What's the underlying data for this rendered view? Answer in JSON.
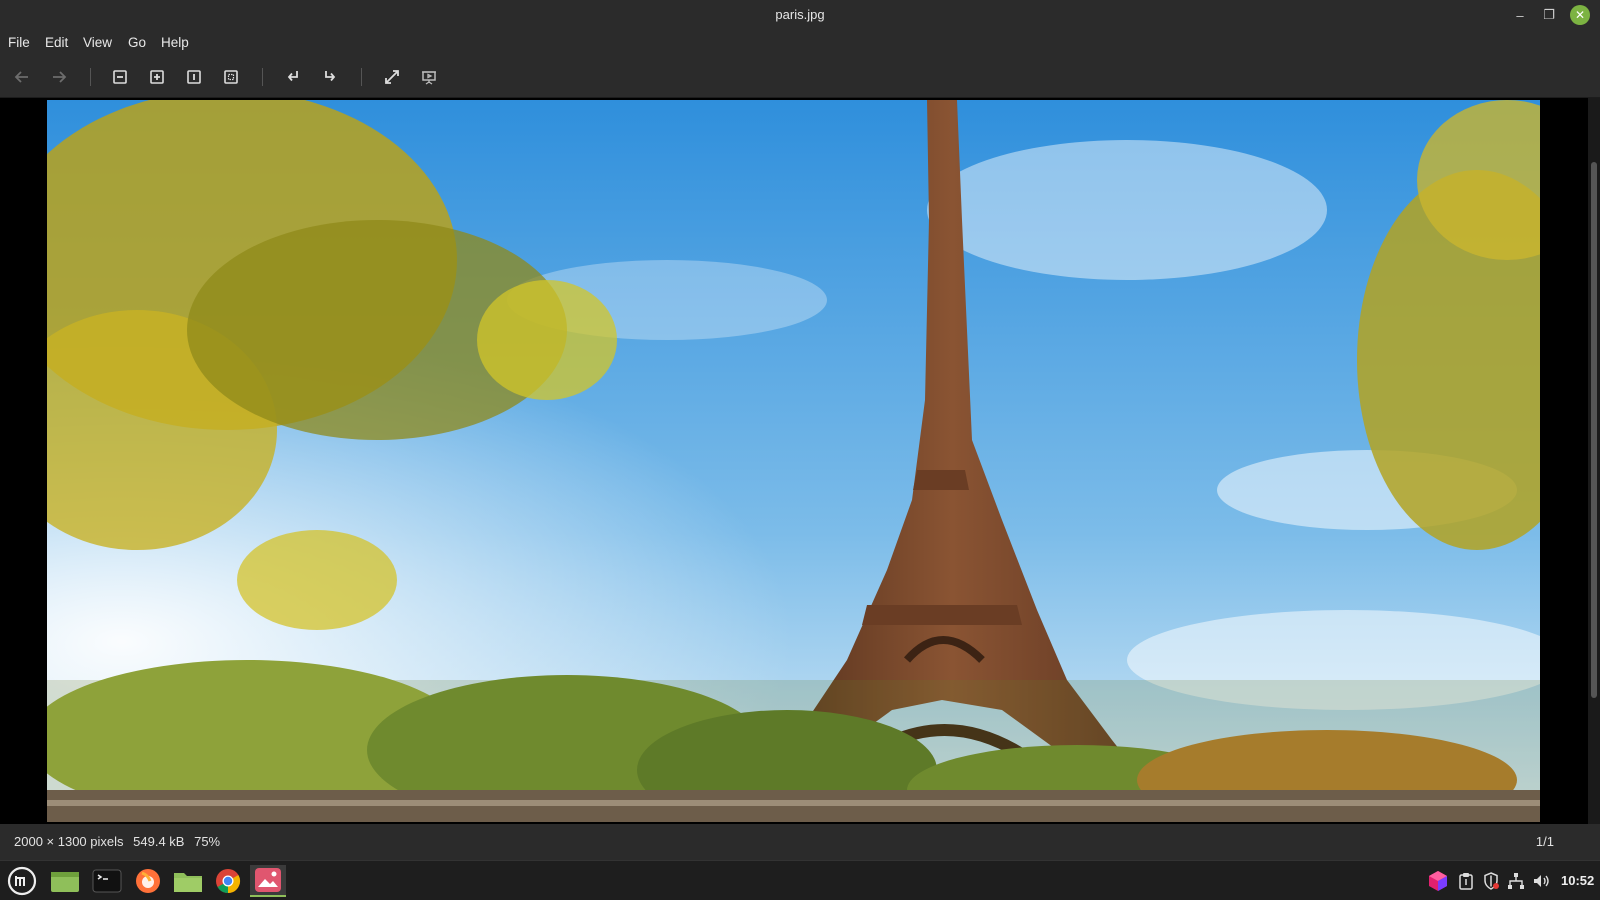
{
  "window": {
    "title": "paris.jpg",
    "minimize_glyph": "–",
    "maximize_glyph": "❐",
    "close_glyph": "✕"
  },
  "menu": [
    "File",
    "Edit",
    "View",
    "Go",
    "Help"
  ],
  "toolbar": {
    "icons": [
      "back-icon",
      "forward-icon",
      "zoom-out-icon",
      "zoom-in-icon",
      "zoom-normal-icon",
      "zoom-fit-icon",
      "rotate-left-icon",
      "rotate-right-icon",
      "fullscreen-icon",
      "slideshow-icon"
    ]
  },
  "status": {
    "dimensions": "2000 × 1300 pixels",
    "filesize": "549.4 kB",
    "zoom": "75%",
    "position": "1/1"
  },
  "taskbar": {
    "apps": [
      "menu-icon",
      "show-desktop-icon",
      "terminal-icon",
      "firefox-icon",
      "files-icon",
      "chrome-icon",
      "image-viewer-icon"
    ],
    "tray": [
      "app-cube-icon",
      "clipboard-icon",
      "shield-icon",
      "network-icon",
      "volume-icon"
    ],
    "time": "10:52"
  },
  "colors": {
    "accent": "#8fbf5a",
    "chrome_bg": "#2b2b2b"
  }
}
